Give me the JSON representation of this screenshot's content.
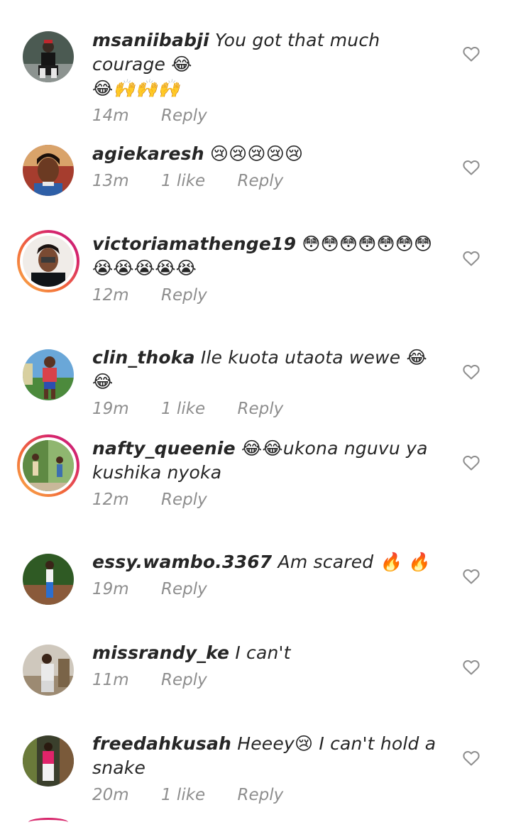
{
  "comments": [
    {
      "username": "msaniibabji",
      "text": "You got that much courage 😂",
      "text2": "😂🙌🙌🙌",
      "time": "14m",
      "likes": "",
      "reply": "Reply"
    },
    {
      "username": "agiekaresh",
      "text": "😢😢😢😢😢",
      "text2": "",
      "time": "13m",
      "likes": "1 like",
      "reply": "Reply"
    },
    {
      "username": "victoriamathenge19",
      "text": "😳😳😳😳😳😳😳",
      "text2": "😭😭😭😭😭",
      "time": "12m",
      "likes": "",
      "reply": "Reply"
    },
    {
      "username": "clin_thoka",
      "text": "Ile kuota utaota wewe 😂😂",
      "text2": "",
      "time": "19m",
      "likes": "1 like",
      "reply": "Reply"
    },
    {
      "username": "nafty_queenie",
      "text": "😂😂ukona nguvu ya",
      "text2": "kushika nyoka",
      "time": "12m",
      "likes": "",
      "reply": "Reply"
    },
    {
      "username": "essy.wambo.3367",
      "text": "Am scared 🔥 🔥",
      "text2": "",
      "time": "19m",
      "likes": "",
      "reply": "Reply"
    },
    {
      "username": "missrandy_ke",
      "text": "I can't",
      "text2": "",
      "time": "11m",
      "likes": "",
      "reply": "Reply"
    },
    {
      "username": "freedahkusah",
      "text": "Heeey😢 I can't hold a snake",
      "text2": "",
      "time": "20m",
      "likes": "1 like",
      "reply": "Reply"
    }
  ],
  "icons": {
    "like": "heart-outline-icon"
  },
  "colors": {
    "text": "#262626",
    "meta": "#8e8e8e",
    "story_ring_start": "#f9b04a",
    "story_ring_end": "#c3207d"
  }
}
